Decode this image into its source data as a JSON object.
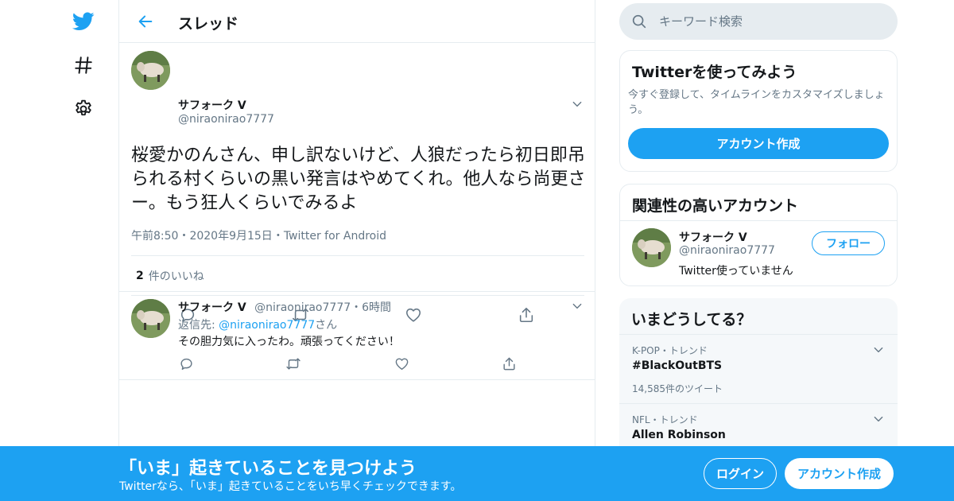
{
  "colors": {
    "accent": "#1da1f2",
    "text": "#14171a",
    "muted": "#657786",
    "border": "#e6ecf0"
  },
  "nav": {
    "icons": [
      "twitter-logo-icon",
      "hashtag-icon",
      "gear-icon"
    ]
  },
  "header": {
    "title": "スレッド",
    "back_icon": "arrow-left-icon"
  },
  "tweet": {
    "name": "サフォーク V",
    "handle": "@niraonirao7777",
    "text": "桜愛かのんさん、申し訳ないけど、人狼だったら初日即吊られる村くらいの黒い発言はやめてくれ。他人なら尚更さー。もう狂人くらいでみるよ",
    "time": "午前8:50",
    "date": "2020年9月15日",
    "source": "Twitter for Android",
    "sep": "・",
    "likes_count": "2",
    "likes_label": "件のいいね"
  },
  "reply": {
    "name": "サフォーク V",
    "handle": "@niraonirao7777",
    "sep": "・",
    "age": "6時間",
    "to_label": "返信先: ",
    "to_handle": "@niraonirao7777",
    "to_suffix": "さん",
    "text": "その胆力気に入ったわ。頑張ってください！"
  },
  "search": {
    "placeholder": "キーワード検索"
  },
  "signup_card": {
    "title": "Twitterを使ってみよう",
    "desc": "今すぐ登録して、タイムラインをカスタマイズしましょう。",
    "button": "アカウント作成"
  },
  "related": {
    "title": "関連性の高いアカウント",
    "name": "サフォーク V",
    "handle": "@niraonirao7777",
    "bio": "Twitter使っていません",
    "follow": "フォロー"
  },
  "trends": {
    "title": "いまどうしてる？",
    "items": [
      {
        "meta": "K-POP・トレンド",
        "name": "#BlackOutBTS",
        "count": "14,585件のツイート"
      },
      {
        "meta": "NFL・トレンド",
        "name": "Allen Robinson"
      }
    ]
  },
  "banner": {
    "title": "「いま」起きていることを見つけよう",
    "sub": "Twitterなら、「いま」起きていることをいち早くチェックできます。",
    "login": "ログイン",
    "signup": "アカウント作成"
  }
}
